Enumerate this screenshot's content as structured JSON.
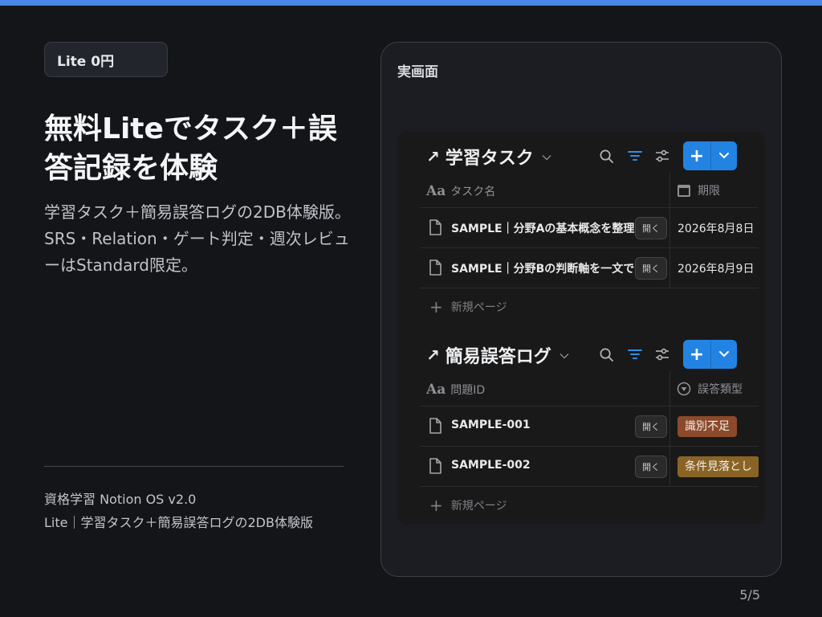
{
  "badge": "Lite 0円",
  "headline": "無料Liteでタスク＋誤答記録を体験",
  "description_lines": [
    "学習タスク＋簡易誤答ログの2DB体験版。",
    "SRS・Relation・ゲート判定・週次レビューはStandard限定。"
  ],
  "footer": {
    "line1": "資格学習 Notion OS v2.0",
    "line2": "Lite｜学習タスク＋簡易誤答ログの2DB体験版"
  },
  "page_number": "5/5",
  "frame_label": "実画面",
  "open_label": "開く",
  "new_page_label": "新規ページ",
  "colors": {
    "accent": "#2383e2",
    "top_bar": "#4a86e8",
    "tag_red": "#8c4a2b",
    "tag_gold": "#8a6425"
  },
  "db1": {
    "title": "学習タスク",
    "col1": "タスク名",
    "col2": "期限",
    "rows": [
      {
        "name": "SAMPLE｜分野Aの基本概念を整理",
        "date": "2026年8月8日"
      },
      {
        "name": "SAMPLE｜分野Bの判断軸を一文で",
        "date": "2026年8月9日"
      }
    ]
  },
  "db2": {
    "title": "簡易誤答ログ",
    "col1": "問題ID",
    "col2": "誤答類型",
    "rows": [
      {
        "name": "SAMPLE-001",
        "tag": "識別不足"
      },
      {
        "name": "SAMPLE-002",
        "tag": "条件見落とし"
      }
    ]
  }
}
